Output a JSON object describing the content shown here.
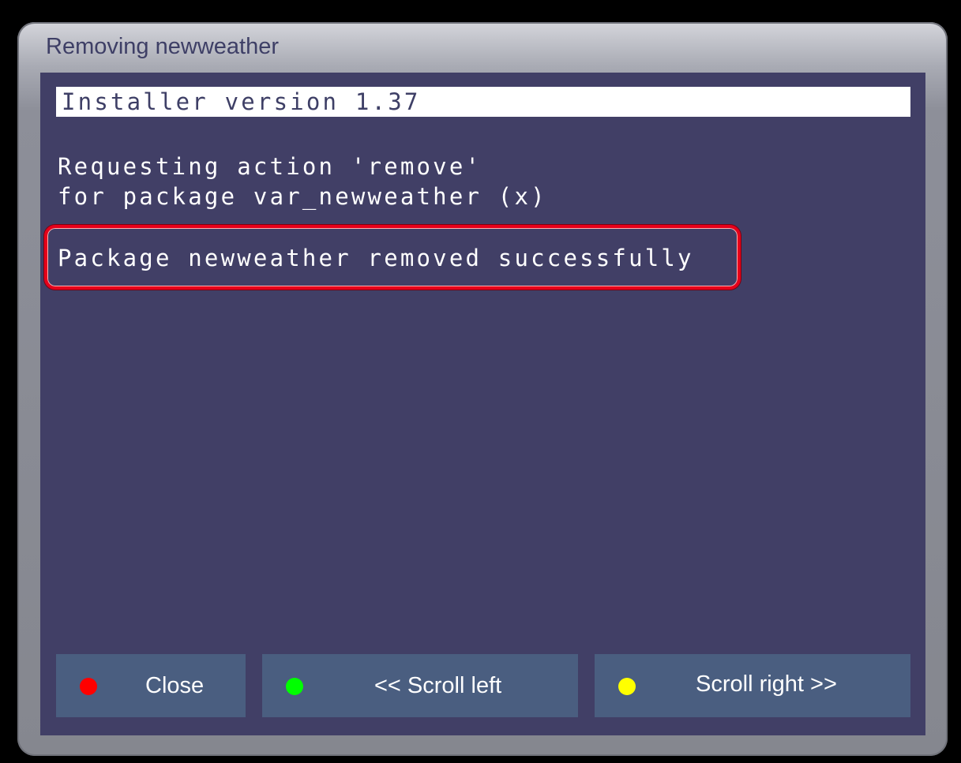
{
  "window": {
    "title": "Removing newweather"
  },
  "log": {
    "version_line": "Installer version 1.37",
    "lines": [
      "Requesting action 'remove'",
      "for package var_newweather (x)"
    ],
    "success_line": "Package newweather removed successfully"
  },
  "buttons": [
    {
      "label": "Close",
      "color_key": "red",
      "icon": "red-dot-icon"
    },
    {
      "label": "<< Scroll left",
      "color_key": "green",
      "icon": "green-dot-icon"
    },
    {
      "label": "Scroll right >>",
      "color_key": "yellow",
      "icon": "yellow-dot-icon"
    }
  ],
  "colors": {
    "panel_bg": "#413f66",
    "button_bg": "#4a5e80",
    "highlight_border": "#e6001a",
    "red": "#ff0000",
    "green": "#00ff00",
    "yellow": "#ffff00"
  }
}
